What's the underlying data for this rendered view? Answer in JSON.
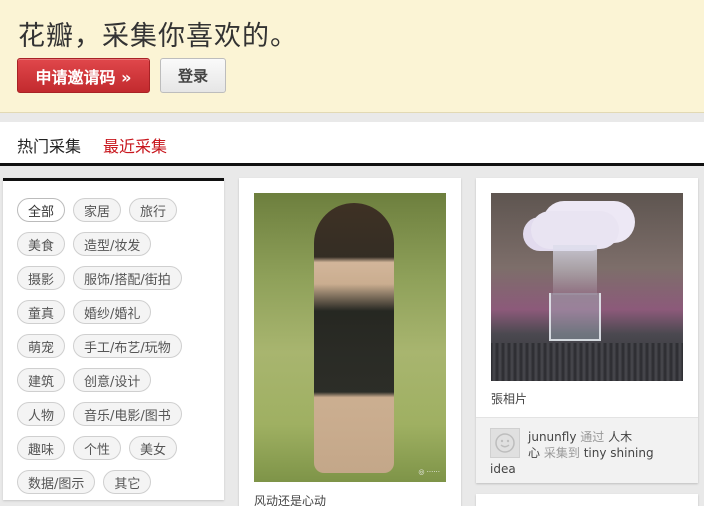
{
  "banner": {
    "slogan": "花瓣，采集你喜欢的。",
    "invite_button": "申请邀请码 »",
    "login_button": "登录"
  },
  "nav": {
    "tabs": [
      {
        "label": "热门采集",
        "active": true
      },
      {
        "label": "最近采集",
        "active": false
      }
    ]
  },
  "categories": [
    [
      "全部",
      "家居",
      "旅行"
    ],
    [
      "美食",
      "造型/妆发"
    ],
    [
      "摄影",
      "服饰/搭配/街拍"
    ],
    [
      "童真",
      "婚纱/婚礼"
    ],
    [
      "萌宠",
      "手工/布艺/玩物"
    ],
    [
      "建筑",
      "创意/设计"
    ],
    [
      "人物",
      "音乐/电影/图书"
    ],
    [
      "趣味",
      "个性",
      "美女"
    ],
    [
      "数据/图示",
      "其它"
    ]
  ],
  "pins": [
    {
      "caption": "风动还是心动",
      "image_icon": "photo-woman-dress"
    },
    {
      "caption": "張相片",
      "image_icon": "photo-cloud-glass",
      "user": "jununfly",
      "via_word": "通过",
      "via_user": "人木",
      "via_user_tail": "心",
      "collected_to": "采集到",
      "board": "tiny shining",
      "board_tail": "idea",
      "avatar_icon": "default-avatar-icon"
    }
  ],
  "colors": {
    "accent_red": "#c8161d",
    "banner_bg": "#fbf4d5"
  }
}
